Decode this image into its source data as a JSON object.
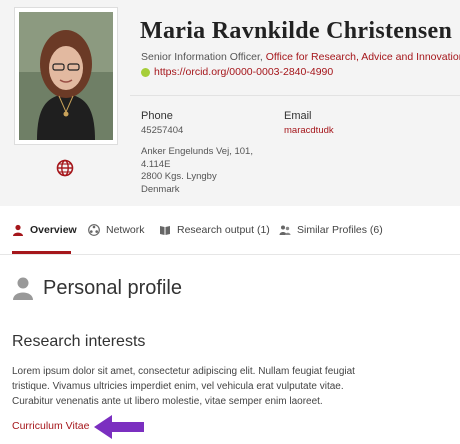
{
  "profile": {
    "name": "Maria Ravnkilde Christensen",
    "position": "Senior Information Officer,",
    "organization": "Office for Research, Advice and Innovation",
    "orcid_url": "https://orcid.org/0000-0003-2840-4990"
  },
  "contact": {
    "phone_label": "Phone",
    "phone": "45257404",
    "email_label": "Email",
    "email": "maracdtudk",
    "address_lines": [
      "Anker Engelunds Vej, 101,",
      "4.114E",
      "2800 Kgs. Lyngby",
      "Denmark"
    ]
  },
  "tabs": [
    {
      "label": "Overview",
      "icon": "person-icon",
      "active": true
    },
    {
      "label": "Network",
      "icon": "network-icon",
      "active": false
    },
    {
      "label": "Research output (1)",
      "icon": "book-icon",
      "active": false
    },
    {
      "label": "Similar Profiles (6)",
      "icon": "people-icon",
      "active": false
    }
  ],
  "main": {
    "section_title": "Personal profile",
    "research_heading": "Research interests",
    "paragraph_lines": [
      "Lorem ipsum dolor sit amet, consectetur adipiscing elit. Nullam feugiat feugiat",
      "tristique. Vivamus ultricies imperdiet enim, vel vehicula erat vulputate vitae.",
      "Curabitur venenatis ante ut libero molestie, vitae semper enim laoreet."
    ],
    "cv_link": "Curriculum Vitae"
  },
  "colors": {
    "accent": "#a5161b",
    "orcid": "#a6ce39",
    "arrow": "#7b2fc0"
  }
}
